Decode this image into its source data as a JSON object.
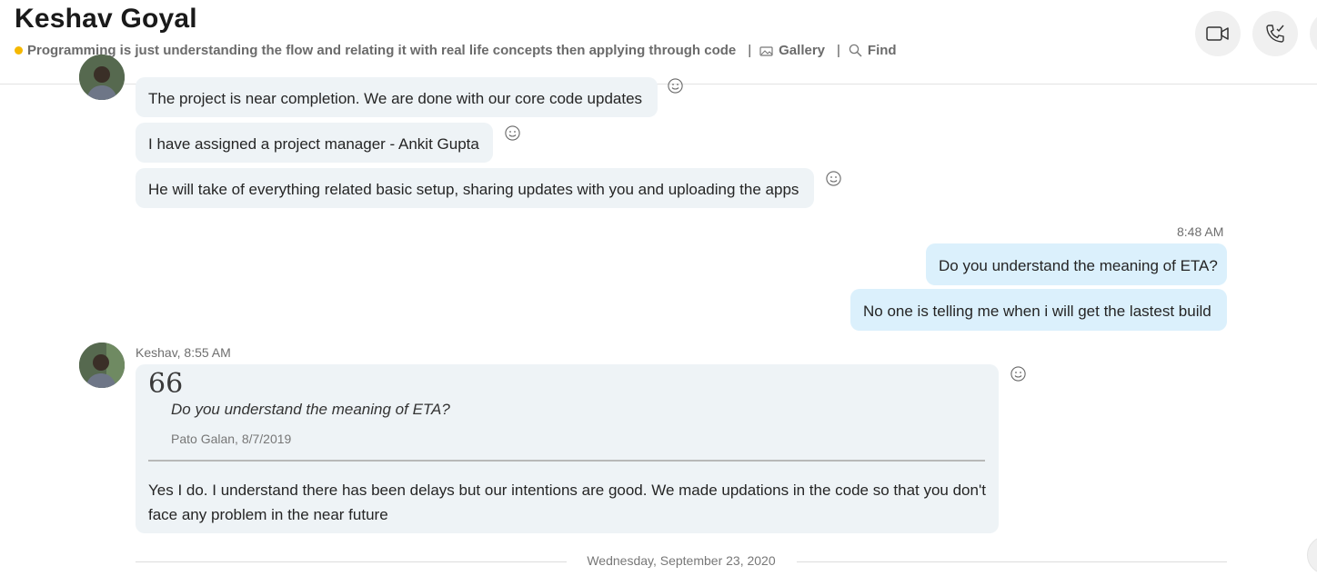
{
  "header": {
    "contact_name": "Keshav Goyal",
    "mood_message": "Programming is just understanding the flow and relating it with real life concepts then applying through code",
    "separator": "|",
    "gallery_label": "Gallery",
    "find_label": "Find",
    "mood_color": "#f5b800"
  },
  "messages": {
    "earlier_1": "The project is near completion. We are done with our core code updates",
    "earlier_2": "I have assigned a project manager - Ankit Gupta",
    "earlier_3": "He will take of everything related basic setup, sharing updates with you and uploading the apps",
    "out_time": "8:48 AM",
    "out_1": "Do you understand the meaning of ETA?",
    "out_2": "No one is telling me when i will get the lastest build",
    "reply_sender_time": "Keshav, 8:55 AM",
    "quote_mark": "66",
    "quoted_text": "Do you understand the meaning of ETA?",
    "quoted_meta": "Pato Galan, 8/7/2019",
    "reply_text": "Yes I do. I understand there has been delays but our intentions are good. We made updations in the code so that you don't face any problem in the near future"
  },
  "date_divider": "Wednesday, September 23, 2020",
  "icons": {
    "video_call": "video-camera-icon",
    "audio_call": "phone-call-icon",
    "gallery": "gallery-icon",
    "find": "search-icon",
    "reaction": "smiley-icon"
  },
  "colors": {
    "incoming_bubble": "#eef3f6",
    "outgoing_bubble": "#dbf0fc"
  }
}
